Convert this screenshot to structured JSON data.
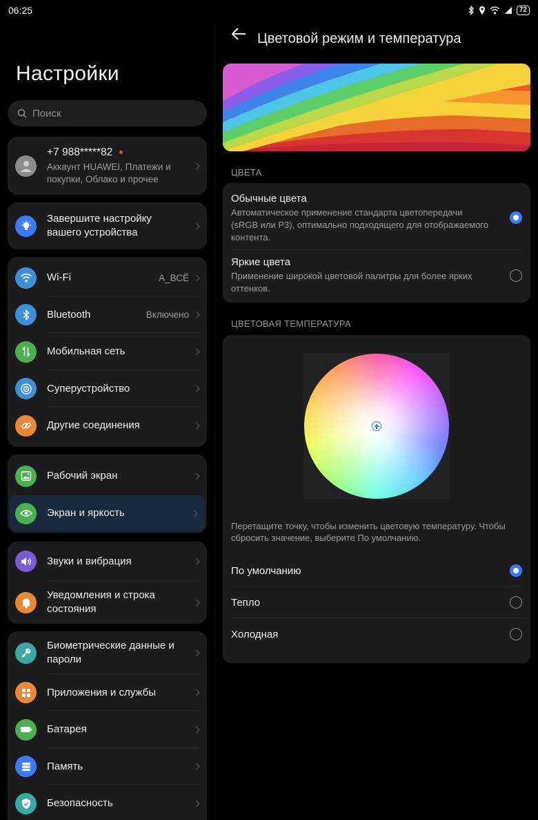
{
  "status": {
    "time": "06:25",
    "battery": "72"
  },
  "left": {
    "title": "Настройки",
    "search_placeholder": "Поиск",
    "account": {
      "phone": "+7 988*****82",
      "subtitle_line1": "Аккаунт HUAWEI, Платежи и",
      "subtitle_line2": "покупки, Облако и прочее"
    },
    "setup": {
      "line1": "Завершите настройку",
      "line2": "вашего устройства"
    },
    "group1": [
      {
        "label": "Wi-Fi",
        "value": "A_ВСЁ",
        "icon": "wifi-icon",
        "color": "#3e8fd8"
      },
      {
        "label": "Bluetooth",
        "value": "Включено",
        "icon": "bluetooth-icon",
        "color": "#3e8fd8"
      },
      {
        "label": "Мобильная сеть",
        "value": "",
        "icon": "mobile-network-icon",
        "color": "#4caf50"
      },
      {
        "label": "Суперустройство",
        "value": "",
        "icon": "super-device-icon",
        "color": "#3e8fd8"
      },
      {
        "label": "Другие соединения",
        "value": "",
        "icon": "link-icon",
        "color": "#e8883a"
      }
    ],
    "group2": [
      {
        "label": "Рабочий экран",
        "icon": "home-screen-icon",
        "color": "#4caf50"
      },
      {
        "label": "Экран и яркость",
        "icon": "eye-icon",
        "color": "#4caf50"
      }
    ],
    "group3": {
      "sound": "Звуки и вибрация",
      "notif_line1": "Уведомления и строка",
      "notif_line2": "состояния"
    },
    "group4": {
      "bio_line1": "Биометрические данные и",
      "bio_line2": "пароли",
      "apps": "Приложения и службы",
      "battery": "Батарея",
      "storage": "Память",
      "security": "Безопасность"
    }
  },
  "right": {
    "title": "Цветовой режим и температура",
    "colors_header": "ЦВЕТА",
    "normal": {
      "title": "Обычные цвета",
      "desc": "Автоматическое применение стандарта цветопередачи (sRGB или P3), оптимально подходящего для отображаемого контента.",
      "selected": true
    },
    "vivid": {
      "title": "Яркие цвета",
      "desc": "Применение широкой цветовой палитры для более ярких оттенков.",
      "selected": false
    },
    "temp_header": "ЦВЕТОВАЯ ТЕМПЕРАТУРА",
    "hint": "Перетащите точку, чтобы изменить цветовую температуру. Чтобы сбросить значение, выберите По умолчанию.",
    "temps": [
      {
        "label": "По умолчанию",
        "selected": true
      },
      {
        "label": "Тепло",
        "selected": false
      },
      {
        "label": "Холодная",
        "selected": false
      }
    ],
    "accent": "#3d7af5"
  }
}
